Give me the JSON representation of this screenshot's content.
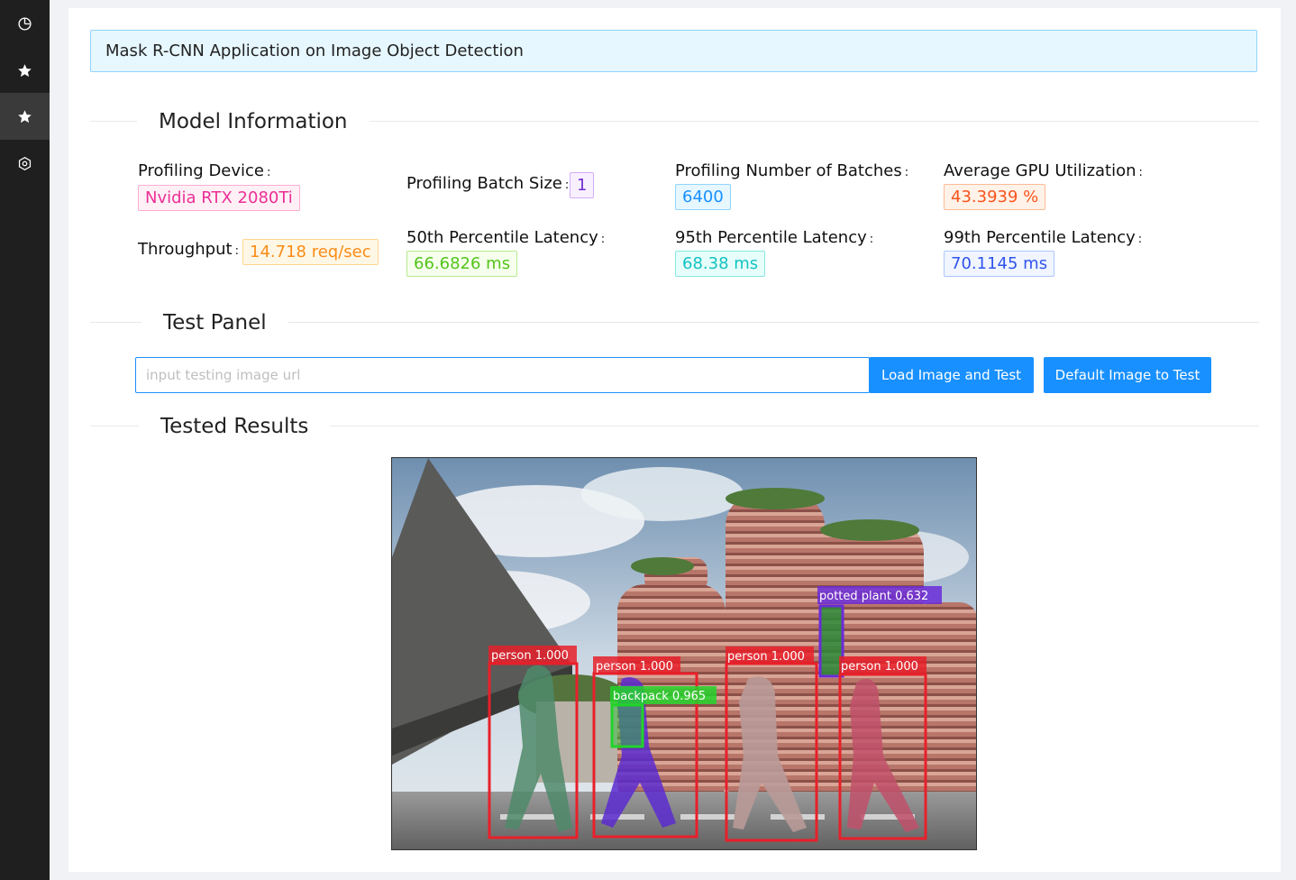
{
  "sidebar": {
    "items": [
      {
        "icon": "dashboard-clock-icon",
        "active": false
      },
      {
        "icon": "star-icon",
        "active": false
      },
      {
        "icon": "star-icon",
        "active": true
      },
      {
        "icon": "hexagon-settings-icon",
        "active": false
      }
    ]
  },
  "banner": {
    "title": "Mask R-CNN Application on Image Object Detection"
  },
  "sections": {
    "model_info": "Model Information",
    "test_panel": "Test Panel",
    "tested_results": "Tested Results"
  },
  "stats": {
    "device": {
      "label": "Profiling Device",
      "value": "Nvidia RTX 2080Ti",
      "color": "#eb2f96"
    },
    "batch_size": {
      "label": "Profiling Batch Size",
      "value": "1",
      "color": "#722ed1"
    },
    "num_batches": {
      "label": "Profiling Number of Batches",
      "value": "6400",
      "color": "#1890ff"
    },
    "gpu_util": {
      "label": "Average GPU Utilization",
      "value": "43.3939 %",
      "color": "#fa541c"
    },
    "throughput": {
      "label": "Throughput",
      "value": "14.718 req/sec",
      "color": "#fa8c16"
    },
    "p50": {
      "label": "50th Percentile Latency",
      "value": "66.6826 ms",
      "color": "#52c41a"
    },
    "p95": {
      "label": "95th Percentile Latency",
      "value": "68.38 ms",
      "color": "#13c2c2"
    },
    "p99": {
      "label": "99th Percentile Latency",
      "value": "70.1145 ms",
      "color": "#2f54eb"
    }
  },
  "test_panel": {
    "url_placeholder": "input testing image url",
    "url_value": "",
    "load_button": "Load Image and Test",
    "default_button": "Default Image to Test"
  },
  "detections": [
    {
      "label": "person 1.000",
      "color": "#e8202a"
    },
    {
      "label": "person 1.000",
      "color": "#e8202a"
    },
    {
      "label": "backpack 0.965",
      "color": "#22d32a"
    },
    {
      "label": "person 1.000",
      "color": "#e8202a"
    },
    {
      "label": "potted plant 0.632",
      "color": "#6a2bd8"
    },
    {
      "label": "person 1.000",
      "color": "#e8202a"
    }
  ]
}
